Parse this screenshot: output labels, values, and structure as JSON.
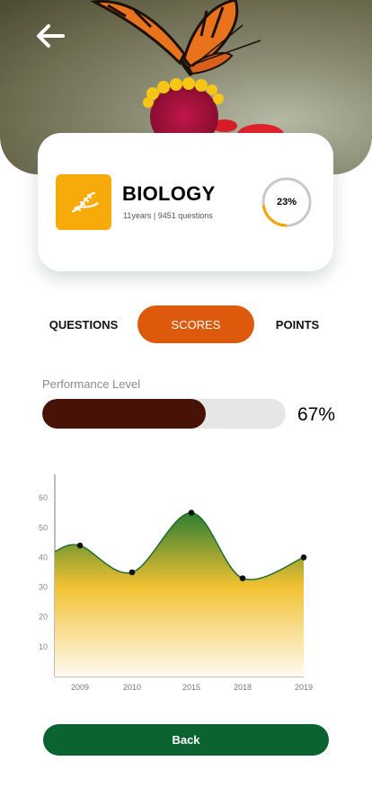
{
  "header": {
    "back_icon": "arrow-left-icon",
    "image": "butterfly-on-flower-photo"
  },
  "subject": {
    "icon": "dna-icon",
    "title": "BIOLOGY",
    "meta": "11years | 9451 questions",
    "progress_percent": 23,
    "progress_label": "23%"
  },
  "tabs": [
    {
      "label": "QUESTIONS",
      "active": false
    },
    {
      "label": "SCORES",
      "active": true
    },
    {
      "label": "POINTS",
      "active": false
    }
  ],
  "performance": {
    "label": "Performance Level",
    "percent": 67,
    "value_label": "67%"
  },
  "chart_data": {
    "type": "area",
    "categories": [
      "2009",
      "2010",
      "2015",
      "2018",
      "2019"
    ],
    "values": [
      44,
      35,
      55,
      33,
      40
    ],
    "yticks": [
      10,
      20,
      30,
      40,
      50,
      60
    ],
    "ylim": [
      0,
      70
    ],
    "grid": false,
    "colors": {
      "line": "#236b2f",
      "fill_top": "#2e7d32",
      "fill_mid": "#f1c232",
      "fill_bottom": "#fffaf0",
      "point": "#111111"
    }
  },
  "back_button": {
    "label": "Back"
  },
  "colors": {
    "accent": "#dd5a0d",
    "brand_green": "#0a6330",
    "icon_bg": "#f7ab0a",
    "progress_fill": "#461306",
    "ring_progress": "#f5a400",
    "ring_track": "#c8c8c8"
  }
}
